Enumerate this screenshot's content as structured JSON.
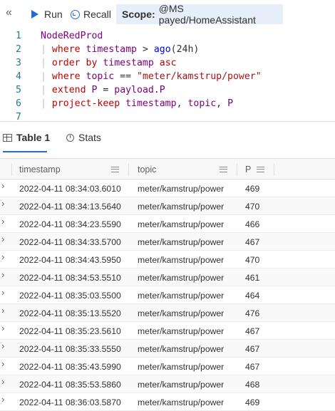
{
  "toolbar": {
    "collapse_glyph": "«",
    "run_label": "Run",
    "recall_label": "Recall",
    "scope_label": "Scope:",
    "scope_value": "@MS payed/HomeAssistant"
  },
  "editor": {
    "lines": [
      {
        "n": "1",
        "tokens": [
          {
            "t": "NodeRedProd",
            "c": "id"
          }
        ]
      },
      {
        "n": "2",
        "tokens": [
          {
            "t": "| ",
            "c": "pipe"
          },
          {
            "t": "where ",
            "c": "kw"
          },
          {
            "t": "timestamp",
            "c": "id"
          },
          {
            "t": " > ",
            "c": "plain"
          },
          {
            "t": "ago",
            "c": "fn"
          },
          {
            "t": "(24h)",
            "c": "plain"
          }
        ]
      },
      {
        "n": "3",
        "tokens": [
          {
            "t": "| ",
            "c": "pipe"
          },
          {
            "t": "order ",
            "c": "kw"
          },
          {
            "t": "by ",
            "c": "kw"
          },
          {
            "t": "timestamp ",
            "c": "id"
          },
          {
            "t": "asc",
            "c": "kw"
          }
        ]
      },
      {
        "n": "4",
        "tokens": [
          {
            "t": "| ",
            "c": "pipe"
          },
          {
            "t": "where ",
            "c": "kw"
          },
          {
            "t": "topic",
            "c": "id"
          },
          {
            "t": " == ",
            "c": "plain"
          },
          {
            "t": "\"meter/kamstrup/power\"",
            "c": "str"
          }
        ]
      },
      {
        "n": "5",
        "tokens": [
          {
            "t": "| ",
            "c": "pipe"
          },
          {
            "t": "extend ",
            "c": "kw"
          },
          {
            "t": "P",
            "c": "id"
          },
          {
            "t": " = ",
            "c": "plain"
          },
          {
            "t": "payload",
            "c": "id"
          },
          {
            "t": ".P",
            "c": "id"
          }
        ]
      },
      {
        "n": "6",
        "tokens": [
          {
            "t": "| ",
            "c": "pipe"
          },
          {
            "t": "project-keep ",
            "c": "kw"
          },
          {
            "t": "timestamp",
            "c": "id"
          },
          {
            "t": ", ",
            "c": "plain"
          },
          {
            "t": "topic",
            "c": "id"
          },
          {
            "t": ", ",
            "c": "plain"
          },
          {
            "t": "P",
            "c": "id"
          }
        ]
      },
      {
        "n": "7",
        "tokens": []
      }
    ]
  },
  "tabs": {
    "table_label": "Table 1",
    "stats_label": "Stats"
  },
  "grid": {
    "columns": [
      "timestamp",
      "topic",
      "P"
    ],
    "rows": [
      [
        "2022-04-11 08:34:03.6010",
        "meter/kamstrup/power",
        "469"
      ],
      [
        "2022-04-11 08:34:13.5640",
        "meter/kamstrup/power",
        "470"
      ],
      [
        "2022-04-11 08:34:23.5590",
        "meter/kamstrup/power",
        "466"
      ],
      [
        "2022-04-11 08:34:33.5700",
        "meter/kamstrup/power",
        "467"
      ],
      [
        "2022-04-11 08:34:43.5950",
        "meter/kamstrup/power",
        "470"
      ],
      [
        "2022-04-11 08:34:53.5510",
        "meter/kamstrup/power",
        "461"
      ],
      [
        "2022-04-11 08:35:03.5500",
        "meter/kamstrup/power",
        "464"
      ],
      [
        "2022-04-11 08:35:13.5520",
        "meter/kamstrup/power",
        "476"
      ],
      [
        "2022-04-11 08:35:23.5610",
        "meter/kamstrup/power",
        "467"
      ],
      [
        "2022-04-11 08:35:33.5550",
        "meter/kamstrup/power",
        "467"
      ],
      [
        "2022-04-11 08:35:43.5990",
        "meter/kamstrup/power",
        "467"
      ],
      [
        "2022-04-11 08:35:53.5860",
        "meter/kamstrup/power",
        "468"
      ],
      [
        "2022-04-11 08:36:03.5870",
        "meter/kamstrup/power",
        "469"
      ]
    ],
    "expander_glyph": "›"
  }
}
